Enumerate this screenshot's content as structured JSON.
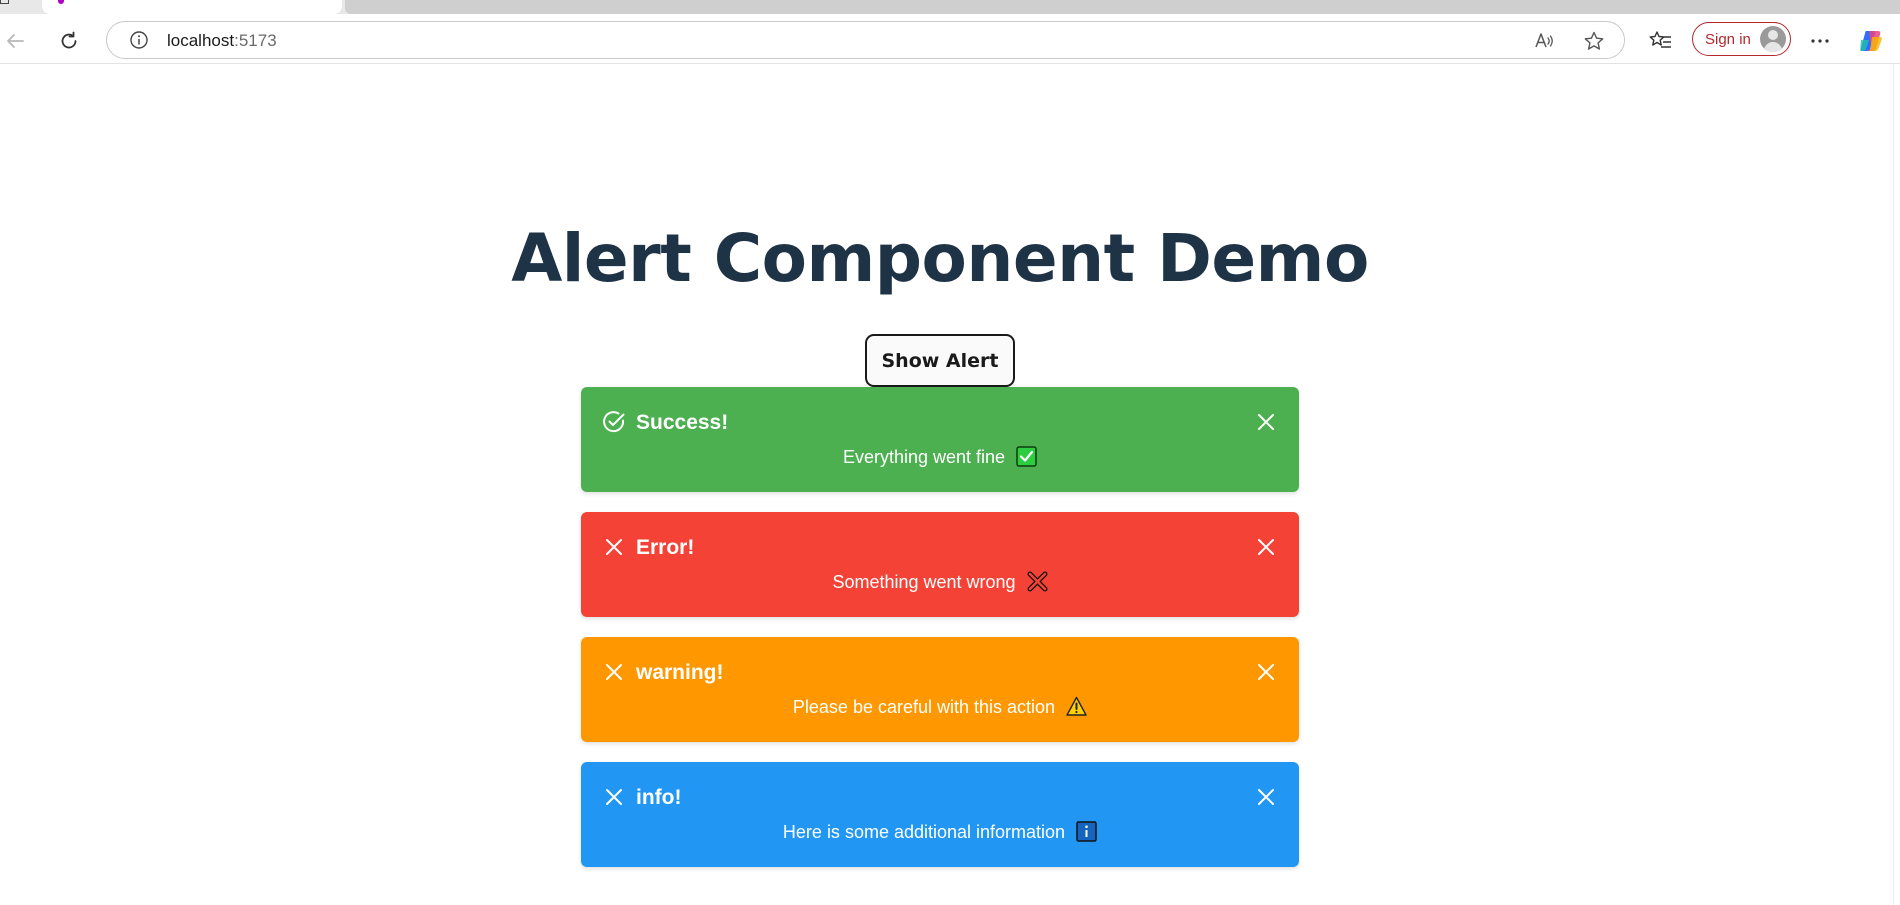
{
  "browser": {
    "url_host": "localhost",
    "url_port": ":5173",
    "signin_label": "Sign in"
  },
  "page": {
    "title": "Alert Component Demo",
    "show_alert_label": "Show Alert"
  },
  "alerts": [
    {
      "type": "success",
      "title": "Success!",
      "message": "Everything went fine",
      "color": "#4caf50",
      "lead_icon": "check-circle-icon",
      "emoji": "check-mark-button-emoji"
    },
    {
      "type": "error",
      "title": "Error!",
      "message": "Something went wrong",
      "color": "#f44336",
      "lead_icon": "close-icon",
      "emoji": "cross-mark-emoji"
    },
    {
      "type": "warning",
      "title": "warning!",
      "message": "Please be careful with this action",
      "color": "#ff9800",
      "lead_icon": "close-icon",
      "emoji": "warning-emoji"
    },
    {
      "type": "info",
      "title": "info!",
      "message": "Here is some additional information",
      "color": "#2196f3",
      "lead_icon": "close-icon",
      "emoji": "information-emoji"
    }
  ]
}
